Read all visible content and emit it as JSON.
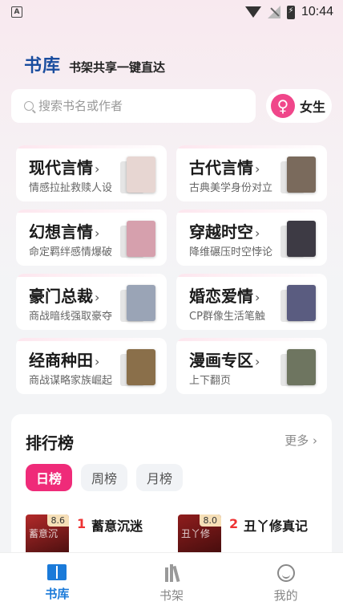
{
  "status_bar": {
    "time": "10:44",
    "app_icon_letter": "A"
  },
  "header": {
    "title": "书库",
    "subtitle": "书架共享一键直达"
  },
  "search": {
    "placeholder": "搜索书名或作者"
  },
  "gender": {
    "label": "女生",
    "icon": "female-icon"
  },
  "categories": [
    {
      "title": "现代言情",
      "desc": "情感拉扯救赎人设",
      "cover_color": "#e7d6d2"
    },
    {
      "title": "古代言情",
      "desc": "古典美学身份对立",
      "cover_color": "#7a6a5c"
    },
    {
      "title": "幻想言情",
      "desc": "命定羁绊感情爆破",
      "cover_color": "#d6a0ad"
    },
    {
      "title": "穿越时空",
      "desc": "降维碾压时空悖论",
      "cover_color": "#3d3a44"
    },
    {
      "title": "豪门总裁",
      "desc": "商战暗线强取豪夺",
      "cover_color": "#9aa4b6"
    },
    {
      "title": "婚恋爱情",
      "desc": "CP群像生活笔触",
      "cover_color": "#5a5c80"
    },
    {
      "title": "经商种田",
      "desc": "商战谋略家族崛起",
      "cover_color": "#8a6f4a"
    },
    {
      "title": "漫画专区",
      "desc": "上下翻页",
      "cover_color": "#6e7560"
    }
  ],
  "ranking": {
    "title": "排行榜",
    "more_label": "更多",
    "tabs": [
      "日榜",
      "周榜",
      "月榜"
    ],
    "items": [
      {
        "rank": "1",
        "name": "蓄意沉迷",
        "score": "8.6",
        "cover_color": "#b32a2a",
        "cover_text": "蓄意沉"
      },
      {
        "rank": "2",
        "name": "丑丫修真记",
        "score": "8.0",
        "cover_color": "#8f1d1d",
        "cover_text": "丑丫修"
      }
    ]
  },
  "bottom_nav": [
    {
      "label": "书库",
      "icon": "book-icon",
      "active": true
    },
    {
      "label": "书架",
      "icon": "bookshelf-icon",
      "active": false
    },
    {
      "label": "我的",
      "icon": "smile-icon",
      "active": false
    }
  ],
  "colors": {
    "brand_blue": "#1a4d9e",
    "accent_pink": "#ef2b79",
    "nav_active": "#1a7ad9",
    "rank_red": "#ee3333"
  }
}
